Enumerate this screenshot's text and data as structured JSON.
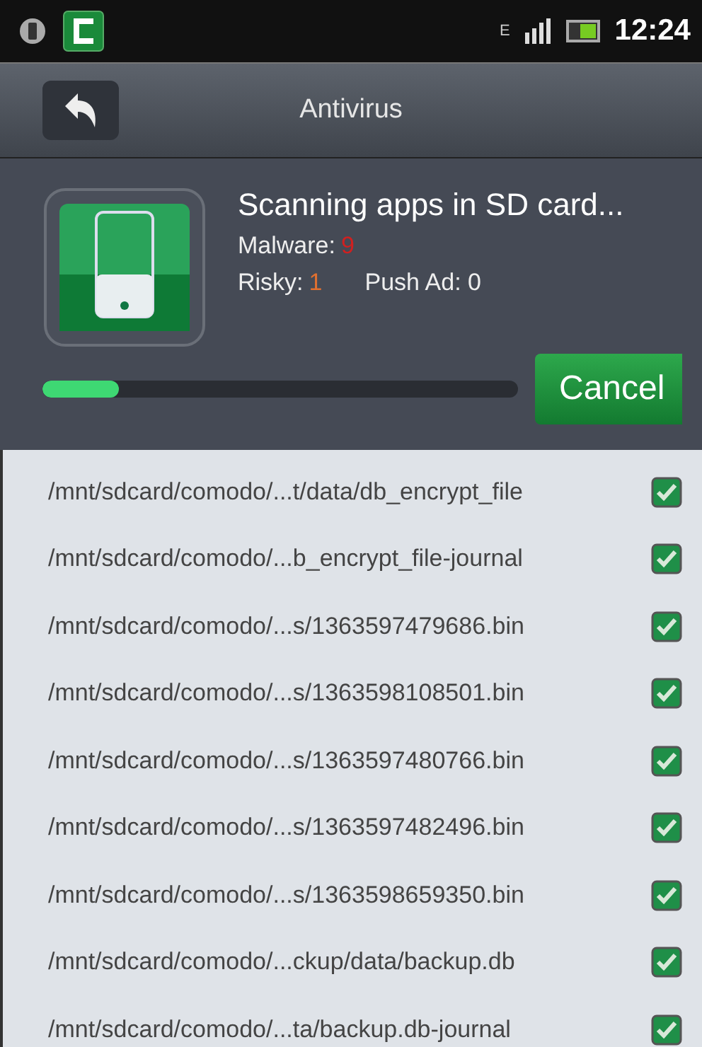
{
  "status_bar": {
    "network": "E",
    "time": "12:24"
  },
  "title_bar": {
    "title": "Antivirus"
  },
  "scan": {
    "heading": "Scanning apps in SD card...",
    "malware_label": "Malware:",
    "malware_count": "9",
    "risky_label": "Risky:",
    "risky_count": "1",
    "push_ad": "Push Ad: 0",
    "level": 0.16,
    "cancel": "Cancel"
  },
  "files": [
    {
      "path": "/mnt/sdcard/comodo/...t/data/db_encrypt_file",
      "checked": true
    },
    {
      "path": "/mnt/sdcard/comodo/...b_encrypt_file-journal",
      "checked": true
    },
    {
      "path": "/mnt/sdcard/comodo/...s/1363597479686.bin",
      "checked": true
    },
    {
      "path": "/mnt/sdcard/comodo/...s/1363598108501.bin",
      "checked": true
    },
    {
      "path": "/mnt/sdcard/comodo/...s/1363597480766.bin",
      "checked": true
    },
    {
      "path": "/mnt/sdcard/comodo/...s/1363597482496.bin",
      "checked": true
    },
    {
      "path": "/mnt/sdcard/comodo/...s/1363598659350.bin",
      "checked": true
    },
    {
      "path": "/mnt/sdcard/comodo/...ckup/data/backup.db",
      "checked": true
    },
    {
      "path": "/mnt/sdcard/comodo/...ta/backup.db-journal",
      "checked": true
    }
  ]
}
